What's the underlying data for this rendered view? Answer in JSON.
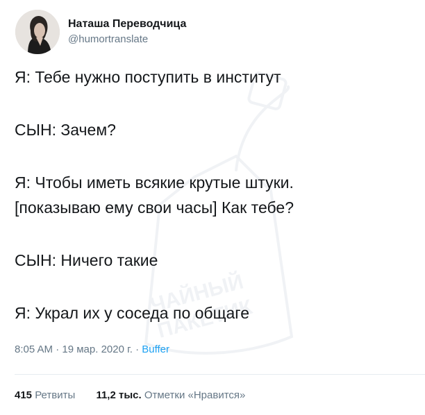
{
  "author": {
    "display_name": "Наташа Переводчица",
    "handle": "@humortranslate",
    "avatar_icon": "user-avatar-photo"
  },
  "tweet": {
    "lines": [
      "Я: Тебе нужно поступить в институт",
      "СЫН: Зачем?",
      "Я: Чтобы иметь всякие крутые штуки.",
      "[показываю ему свои часы] Как тебе?",
      "СЫН: Ничего такие",
      "Я: Украл их у соседа по общаге"
    ]
  },
  "meta": {
    "time": "8:05 AM",
    "separator1": " · ",
    "date": "19 мар. 2020 г.",
    "separator2": " · ",
    "source": "Buffer"
  },
  "stats": {
    "retweets_count": "415",
    "retweets_label": "Ретвиты",
    "likes_count": "11,2 тыс.",
    "likes_label": "Отметки «Нравится»"
  },
  "watermark": {
    "text_line1": "ЧАЙНЫЙ",
    "text_line2": "ПАКЕТИК"
  },
  "colors": {
    "text": "#14171a",
    "secondary": "#657786",
    "link": "#1da1f2",
    "divider": "#e6ecf0"
  }
}
